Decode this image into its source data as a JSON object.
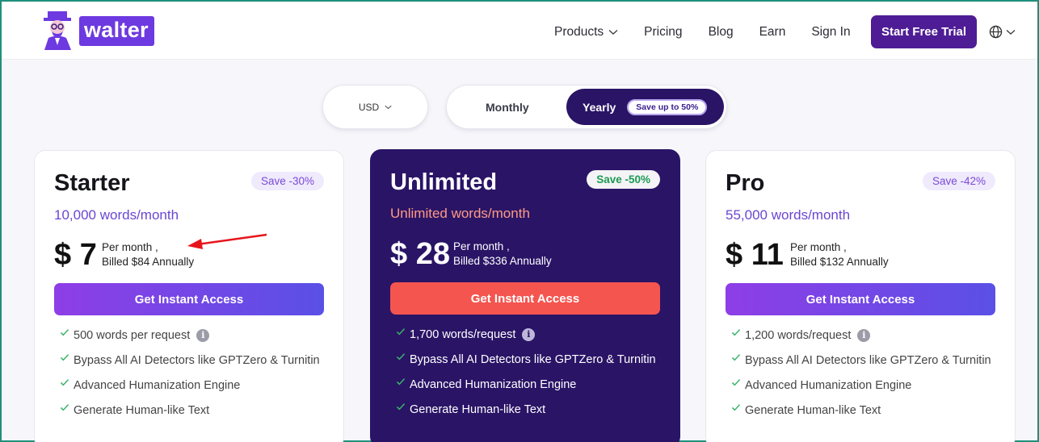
{
  "nav": {
    "logo_text": "walter",
    "links": [
      {
        "label": "Products",
        "has_dropdown": true
      },
      {
        "label": "Pricing"
      },
      {
        "label": "Blog"
      },
      {
        "label": "Earn"
      },
      {
        "label": "Sign In"
      }
    ],
    "cta_label": "Start Free Trial",
    "language_icon": "globe-icon"
  },
  "controls": {
    "currency": "USD",
    "billing_options": [
      "Monthly",
      "Yearly"
    ],
    "selected_billing": "Yearly",
    "yearly_badge": "Save up to 50%"
  },
  "plans": [
    {
      "name": "Starter",
      "badge": "Save -30%",
      "words": "10,000 words/month",
      "price": "$ 7",
      "period": "Per month ,",
      "billed": "Billed $84 Annually",
      "cta": "Get Instant Access",
      "features": [
        "500 words per request",
        "Bypass All AI Detectors like GPTZero & Turnitin",
        "Advanced Humanization Engine",
        "Generate Human-like Text"
      ]
    },
    {
      "name": "Unlimited",
      "badge": "Save -50%",
      "words": "Unlimited words/month",
      "price": "$ 28",
      "period": "Per month ,",
      "billed": "Billed $336 Annually",
      "cta": "Get Instant Access",
      "features": [
        "1,700 words/request",
        "Bypass All AI Detectors like GPTZero & Turnitin",
        "Advanced Humanization Engine",
        "Generate Human-like Text"
      ]
    },
    {
      "name": "Pro",
      "badge": "Save -42%",
      "words": "55,000 words/month",
      "price": "$ 11",
      "period": "Per month ,",
      "billed": "Billed $132 Annually",
      "cta": "Get Instant Access",
      "features": [
        "1,200 words/request",
        "Bypass All AI Detectors like GPTZero & Turnitin",
        "Advanced Humanization Engine",
        "Generate Human-like Text"
      ]
    }
  ],
  "colors": {
    "brand": "#6d39e0",
    "cta": "#4e1d95",
    "featured_card": "#2a1466",
    "featured_button": "#f4554f",
    "check": "#3bb36a",
    "annotation_arrow": "#e8141b"
  }
}
